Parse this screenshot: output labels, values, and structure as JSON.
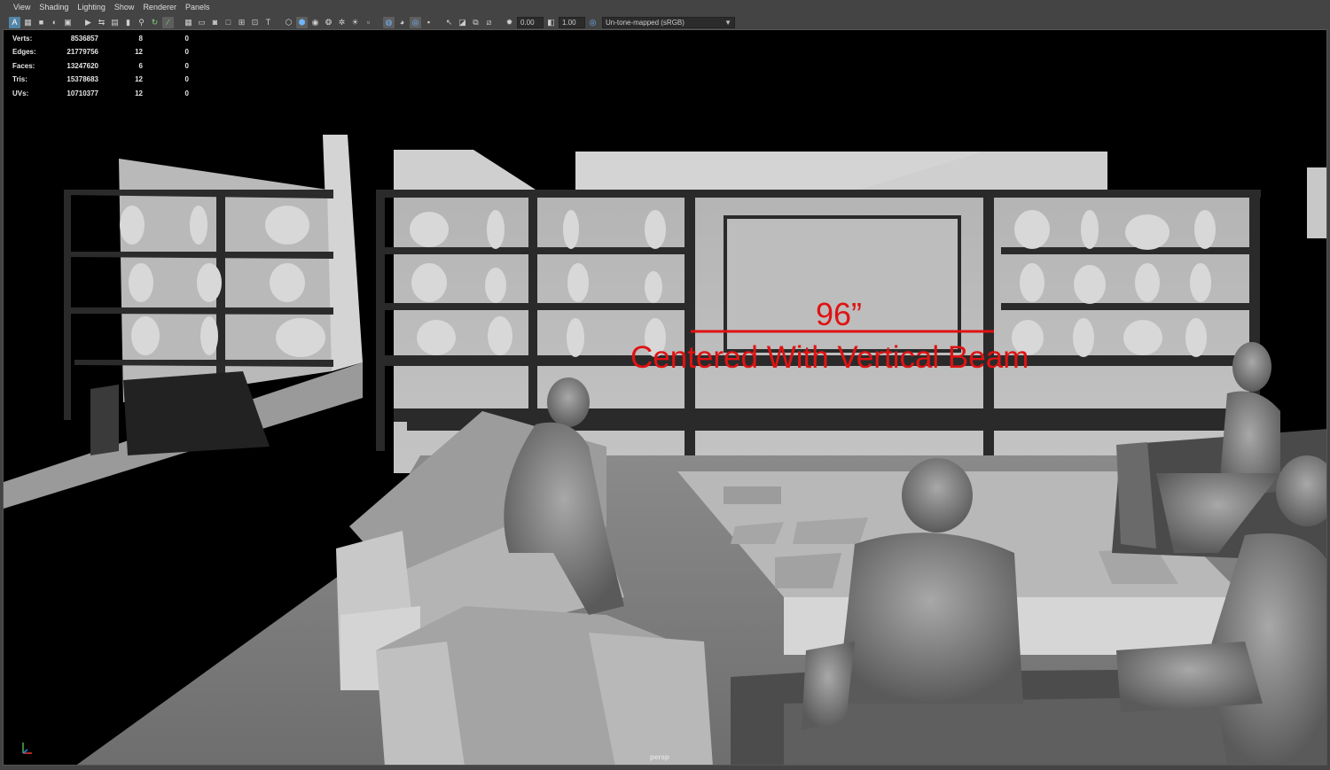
{
  "menu": [
    "View",
    "Shading",
    "Lighting",
    "Show",
    "Renderer",
    "Panels"
  ],
  "toolbar": {
    "exposure": "0.00",
    "gamma": "1.00",
    "color_space": "Un-tone-mapped (sRGB)"
  },
  "hud": {
    "rows": [
      {
        "label": "Verts:",
        "total": "8536857",
        "selected": "8",
        "components": "0"
      },
      {
        "label": "Edges:",
        "total": "21779756",
        "selected": "12",
        "components": "0"
      },
      {
        "label": "Faces:",
        "total": "13247620",
        "selected": "6",
        "components": "0"
      },
      {
        "label": "Tris:",
        "total": "15378683",
        "selected": "12",
        "components": "0"
      },
      {
        "label": "UVs:",
        "total": "10710377",
        "selected": "12",
        "components": "0"
      }
    ]
  },
  "annotation": {
    "measurement": "96”",
    "note": "Centered With Vertical Beam",
    "color": "#e01212"
  },
  "camera_label": "persp",
  "icons": [
    "select-icon",
    "lasso-icon",
    "camera-icon",
    "grid-icon",
    "wireframe-icon",
    "smooth-shade-icon",
    "texture-icon",
    "light-icon",
    "isolate-icon",
    "xray-icon",
    "exposure-icon",
    "gamma-icon",
    "colorspace-icon",
    "axis-gizmo-icon"
  ]
}
